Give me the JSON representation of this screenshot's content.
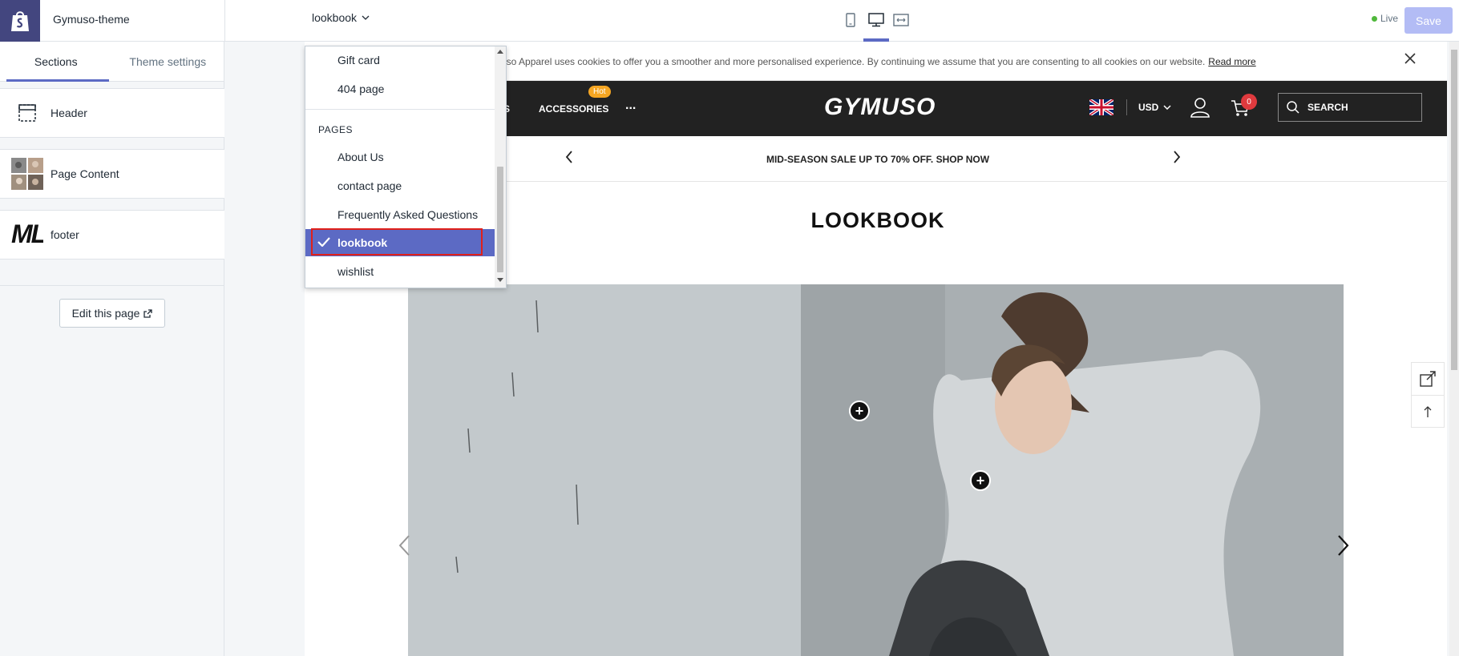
{
  "app": {
    "theme_name": "Gymuso-theme",
    "current_page": "lookbook",
    "live_label": "Live",
    "save_label": "Save",
    "device_icons": [
      "mobile-icon",
      "desktop-icon",
      "fullscreen-icon"
    ]
  },
  "sidebar": {
    "tabs": [
      {
        "label": "Sections",
        "active": true
      },
      {
        "label": "Theme settings",
        "active": false
      }
    ],
    "sections": [
      {
        "label": "Header",
        "icon": "header-layout-icon"
      },
      {
        "label": "Page Content",
        "icon": "image-grid-thumbnail"
      },
      {
        "label": "footer",
        "icon": "footer-thumbnail",
        "thumb_text": "ML"
      }
    ],
    "edit_page_label": "Edit this page"
  },
  "dropdown": {
    "items_top": [
      "Gift card",
      "404 page"
    ],
    "pages_heading": "PAGES",
    "pages": [
      "About Us",
      "contact page",
      "Frequently Asked Questions",
      "lookbook",
      "wishlist"
    ],
    "selected": "lookbook"
  },
  "preview": {
    "cookie_text": "muso Apparel uses cookies to offer you a smoother and more personalised experience. By continuing we assume that you are consenting to all cookies on our website.",
    "cookie_link": "Read more",
    "nav_partial": "S",
    "nav_accessories": "ACCESSORIES",
    "hot_badge": "Hot",
    "nav_more": "...",
    "store_logo": "GYMUSO",
    "currency": "USD",
    "cart_count": "0",
    "search_label": "SEARCH",
    "promo_text": "MID-SEASON SALE UP TO 70% OFF. SHOP NOW",
    "page_title": "LOOKBOOK",
    "hotspot_symbol": "+"
  },
  "colors": {
    "brand_purple": "#43467f",
    "accent": "#5c6ac4",
    "save_disabled": "#b3bcf5",
    "live_green": "#50b83c",
    "store_header_bg": "#222222",
    "hot_badge": "#f5a623",
    "cart_badge": "#e03a3e",
    "selection_outline": "#e0201a"
  }
}
